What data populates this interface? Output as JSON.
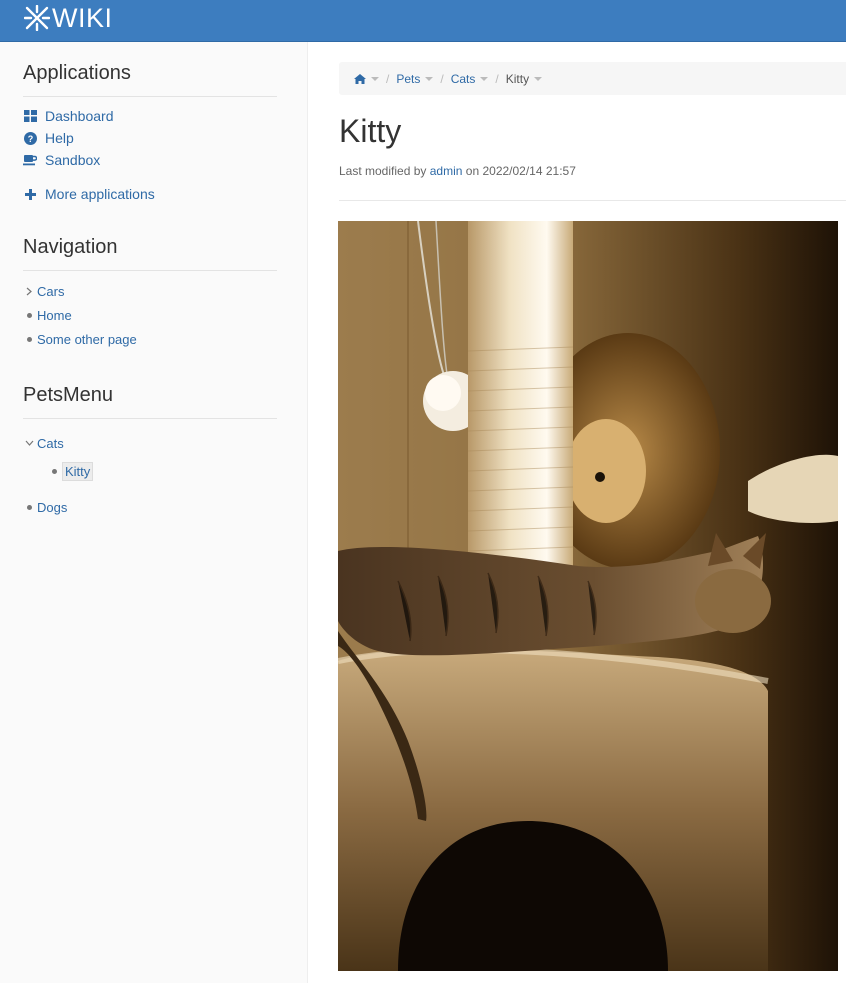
{
  "header": {
    "logo_text": "WIKI",
    "brand_color": "#3d7dbf"
  },
  "sidebar": {
    "applications": {
      "title": "Applications",
      "items": [
        {
          "label": "Dashboard",
          "icon": "dashboard-icon"
        },
        {
          "label": "Help",
          "icon": "question-circle-icon"
        },
        {
          "label": "Sandbox",
          "icon": "coffee-cup-icon"
        }
      ],
      "more_label": "More applications",
      "more_icon": "plus-icon"
    },
    "navigation": {
      "title": "Navigation",
      "items": [
        {
          "label": "Cars",
          "marker": "chevron-right-icon"
        },
        {
          "label": "Home",
          "marker": "bullet"
        },
        {
          "label": "Some other page",
          "marker": "bullet"
        }
      ]
    },
    "pets_menu": {
      "title": "PetsMenu",
      "items": [
        {
          "label": "Cats",
          "marker": "chevron-down-icon"
        },
        {
          "label": "Kitty",
          "marker": "bullet",
          "active": true
        },
        {
          "label": "Dogs",
          "marker": "bullet"
        }
      ]
    }
  },
  "breadcrumb": {
    "home_icon": "home-icon",
    "items": [
      "Pets",
      "Cats",
      "Kitty"
    ]
  },
  "page": {
    "title": "Kitty",
    "meta_prefix": "Last modified by",
    "meta_author": "admin",
    "meta_on": "on",
    "meta_date": "2022/02/14 21:57",
    "image_subject": "sepia photo of a tabby kitten sleeping on a cat tree"
  }
}
